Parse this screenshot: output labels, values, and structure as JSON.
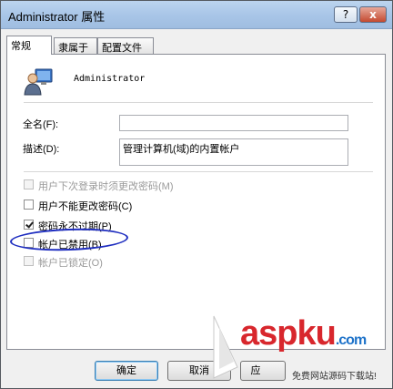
{
  "window": {
    "title": "Administrator 属性",
    "help_glyph": "?",
    "close_glyph": "x"
  },
  "tabs": [
    {
      "label": "常规"
    },
    {
      "label": "隶属于"
    },
    {
      "label": "配置文件"
    }
  ],
  "general": {
    "username": "Administrator",
    "fullname_label": "全名(F):",
    "fullname_value": "",
    "description_label": "描述(D):",
    "description_value": "管理计算机(域)的内置帐户"
  },
  "checkboxes": [
    {
      "label": "用户下次登录时须更改密码(M)",
      "checked": false,
      "disabled": true
    },
    {
      "label": "用户不能更改密码(C)",
      "checked": false,
      "disabled": false
    },
    {
      "label": "密码永不过期(P)",
      "checked": true,
      "disabled": false
    },
    {
      "label": "帐户已禁用(B)",
      "checked": false,
      "disabled": false
    },
    {
      "label": "帐户已锁定(O)",
      "checked": false,
      "disabled": true
    }
  ],
  "buttons": {
    "ok": "确定",
    "cancel": "取消",
    "apply": "应"
  },
  "watermark": {
    "logo_text": "aspku",
    "logo_suffix": ".com",
    "tagline": "免费网站源码下载站!"
  },
  "colors": {
    "annotation": "#1f2ec0",
    "watermark_red": "#d8272d",
    "watermark_blue": "#1d72c9"
  }
}
